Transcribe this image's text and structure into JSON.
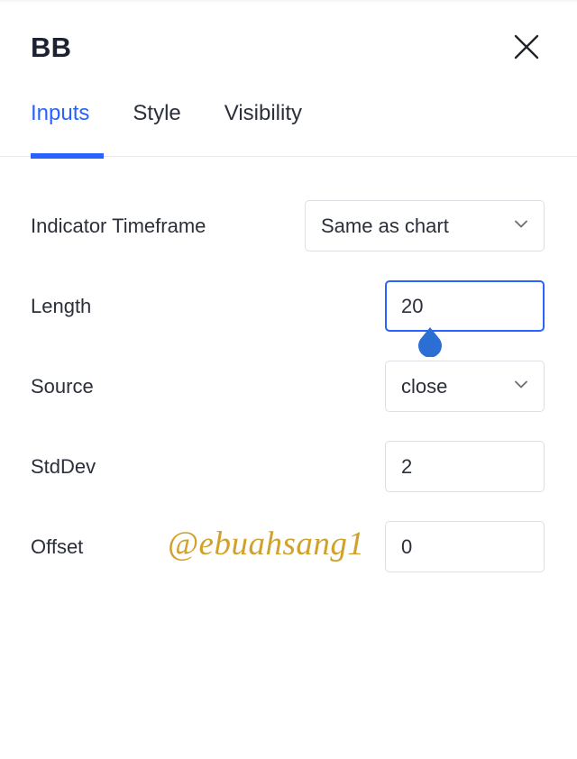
{
  "window": {
    "title": "BB",
    "close_label": "×",
    "close_icon": "close-icon"
  },
  "tabs": {
    "items": [
      {
        "label": "Inputs",
        "active": true
      },
      {
        "label": "Style",
        "active": false
      },
      {
        "label": "Visibility",
        "active": false
      }
    ]
  },
  "inputs": {
    "rows": [
      {
        "label": "Indicator Timeframe",
        "control": "select",
        "value": "Same as chart",
        "icon": "chevron-down-icon",
        "focused": false
      },
      {
        "label": "Length",
        "control": "text",
        "value": "20",
        "focused": true,
        "handle_icon": "text-cursor-handle-icon"
      },
      {
        "label": "Source",
        "control": "select",
        "value": "close",
        "icon": "chevron-down-icon",
        "focused": false
      },
      {
        "label": "StdDev",
        "control": "text",
        "value": "2",
        "focused": false
      },
      {
        "label": "Offset",
        "control": "text",
        "value": "0",
        "focused": false
      }
    ]
  },
  "watermark": {
    "text": "@ebuahsang1"
  },
  "colors": {
    "accent": "#2962ff",
    "text": "#2b2f3a",
    "title": "#1d2130",
    "border": "#dcdfe3",
    "divider": "#e6e8ea",
    "watermark": "#d1a229",
    "background": "#ffffff"
  }
}
